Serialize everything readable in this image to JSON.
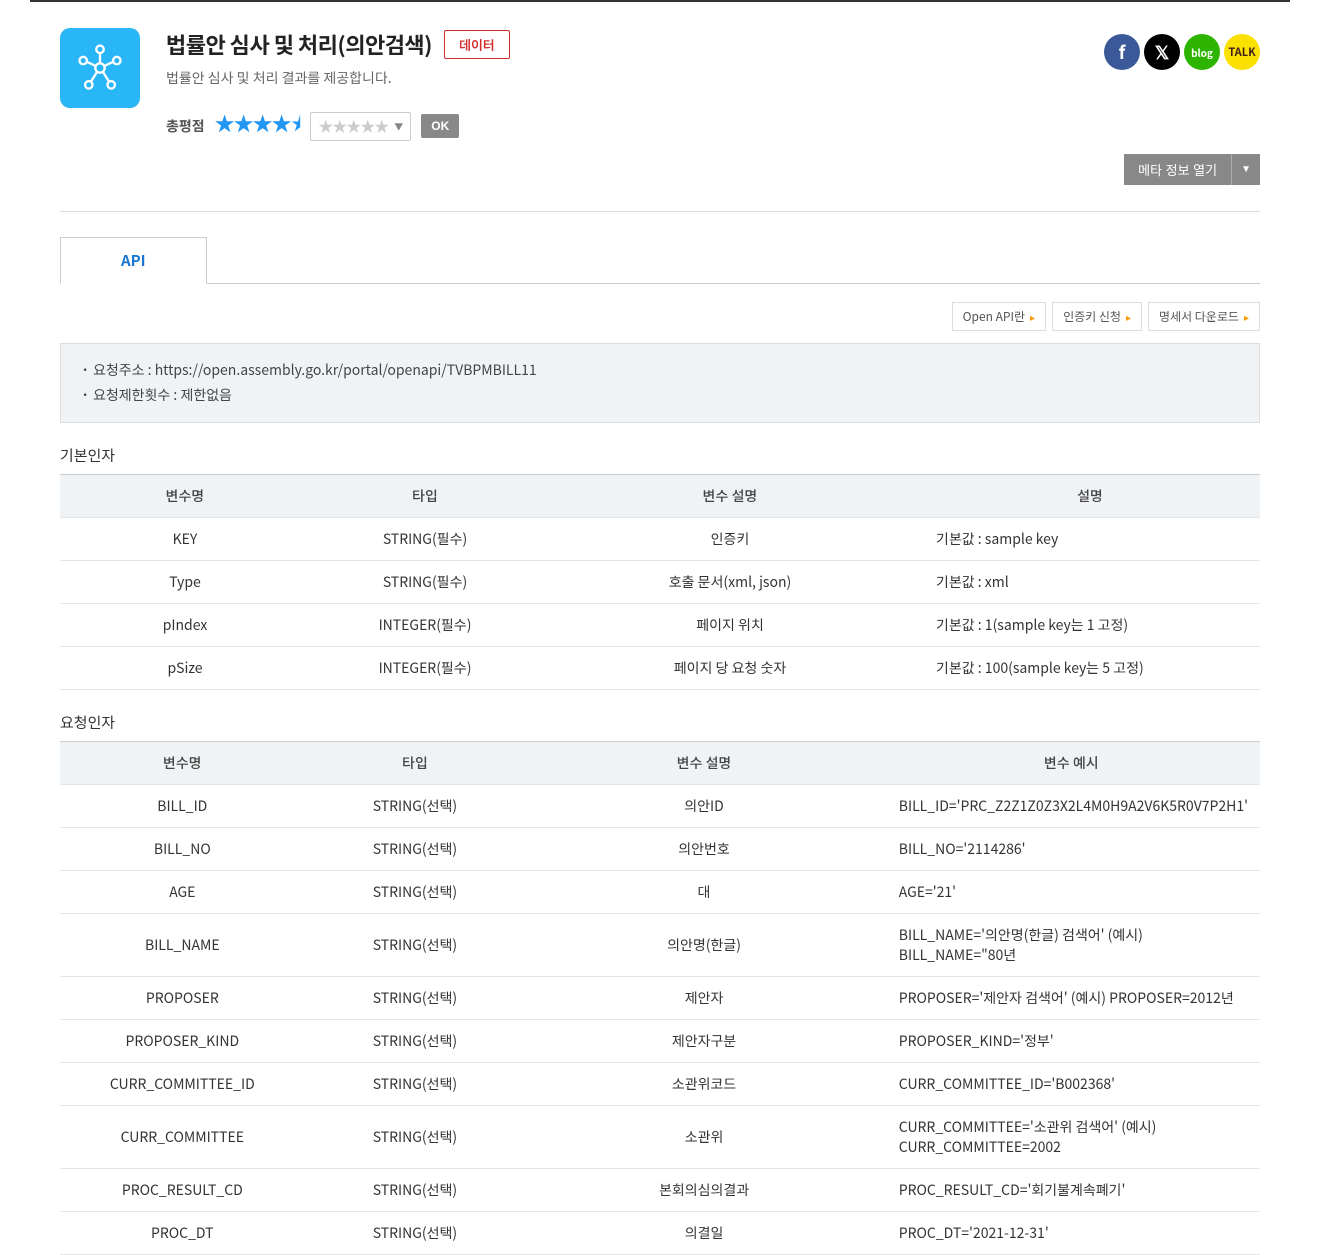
{
  "header": {
    "title": "법률안 심사 및 처리(의안검색)",
    "badge": "데이터",
    "subtitle": "법률안 심사 및 처리 결과를 제공합니다.",
    "rating_label": "총평점",
    "ok_button": "OK",
    "meta_info_button": "메타 정보 열기"
  },
  "tabs": {
    "api": "API"
  },
  "action_links": {
    "open_api": "Open API란",
    "auth_key": "인증키 신청",
    "spec_download": "명세서 다운로드"
  },
  "request_info": {
    "url_label": "요청주소 : ",
    "url": "https://open.assembly.go.kr/portal/openapi/TVBPMBILL11",
    "limit_label": "요청제한횟수 : ",
    "limit": "제한없음"
  },
  "tables": {
    "basic_title": "기본인자",
    "basic_headers": [
      "변수명",
      "타입",
      "변수 설명",
      "설명"
    ],
    "basic_rows": [
      [
        "KEY",
        "STRING(필수)",
        "인증키",
        "기본값 : sample key"
      ],
      [
        "Type",
        "STRING(필수)",
        "호출 문서(xml, json)",
        "기본값 : xml"
      ],
      [
        "pIndex",
        "INTEGER(필수)",
        "페이지 위치",
        "기본값 : 1(sample key는 1 고정)"
      ],
      [
        "pSize",
        "INTEGER(필수)",
        "페이지 당 요청 숫자",
        "기본값 : 100(sample key는 5 고정)"
      ]
    ],
    "req_title": "요청인자",
    "req_headers": [
      "변수명",
      "타입",
      "변수 설명",
      "변수 예시"
    ],
    "req_rows": [
      [
        "BILL_ID",
        "STRING(선택)",
        "의안ID",
        "BILL_ID='PRC_Z2Z1Z0Z3X2L4M0H9A2V6K5R0V7P2H1'"
      ],
      [
        "BILL_NO",
        "STRING(선택)",
        "의안번호",
        "BILL_NO='2114286'"
      ],
      [
        "AGE",
        "STRING(선택)",
        "대",
        "AGE='21'"
      ],
      [
        "BILL_NAME",
        "STRING(선택)",
        "의안명(한글)",
        "BILL_NAME='의안명(한글) 검색어' (예시) BILL_NAME=\"80년"
      ],
      [
        "PROPOSER",
        "STRING(선택)",
        "제안자",
        "PROPOSER='제안자 검색어' (예시) PROPOSER=2012년"
      ],
      [
        "PROPOSER_KIND",
        "STRING(선택)",
        "제안자구분",
        "PROPOSER_KIND='정부'"
      ],
      [
        "CURR_COMMITTEE_ID",
        "STRING(선택)",
        "소관위코드",
        "CURR_COMMITTEE_ID='B002368'"
      ],
      [
        "CURR_COMMITTEE",
        "STRING(선택)",
        "소관위",
        "CURR_COMMITTEE='소관위 검색어' (예시) CURR_COMMITTEE=2002"
      ],
      [
        "PROC_RESULT_CD",
        "STRING(선택)",
        "본회의심의결과",
        "PROC_RESULT_CD='회기불계속폐기'"
      ],
      [
        "PROC_DT",
        "STRING(선택)",
        "의결일",
        "PROC_DT='2021-12-31'"
      ]
    ]
  }
}
